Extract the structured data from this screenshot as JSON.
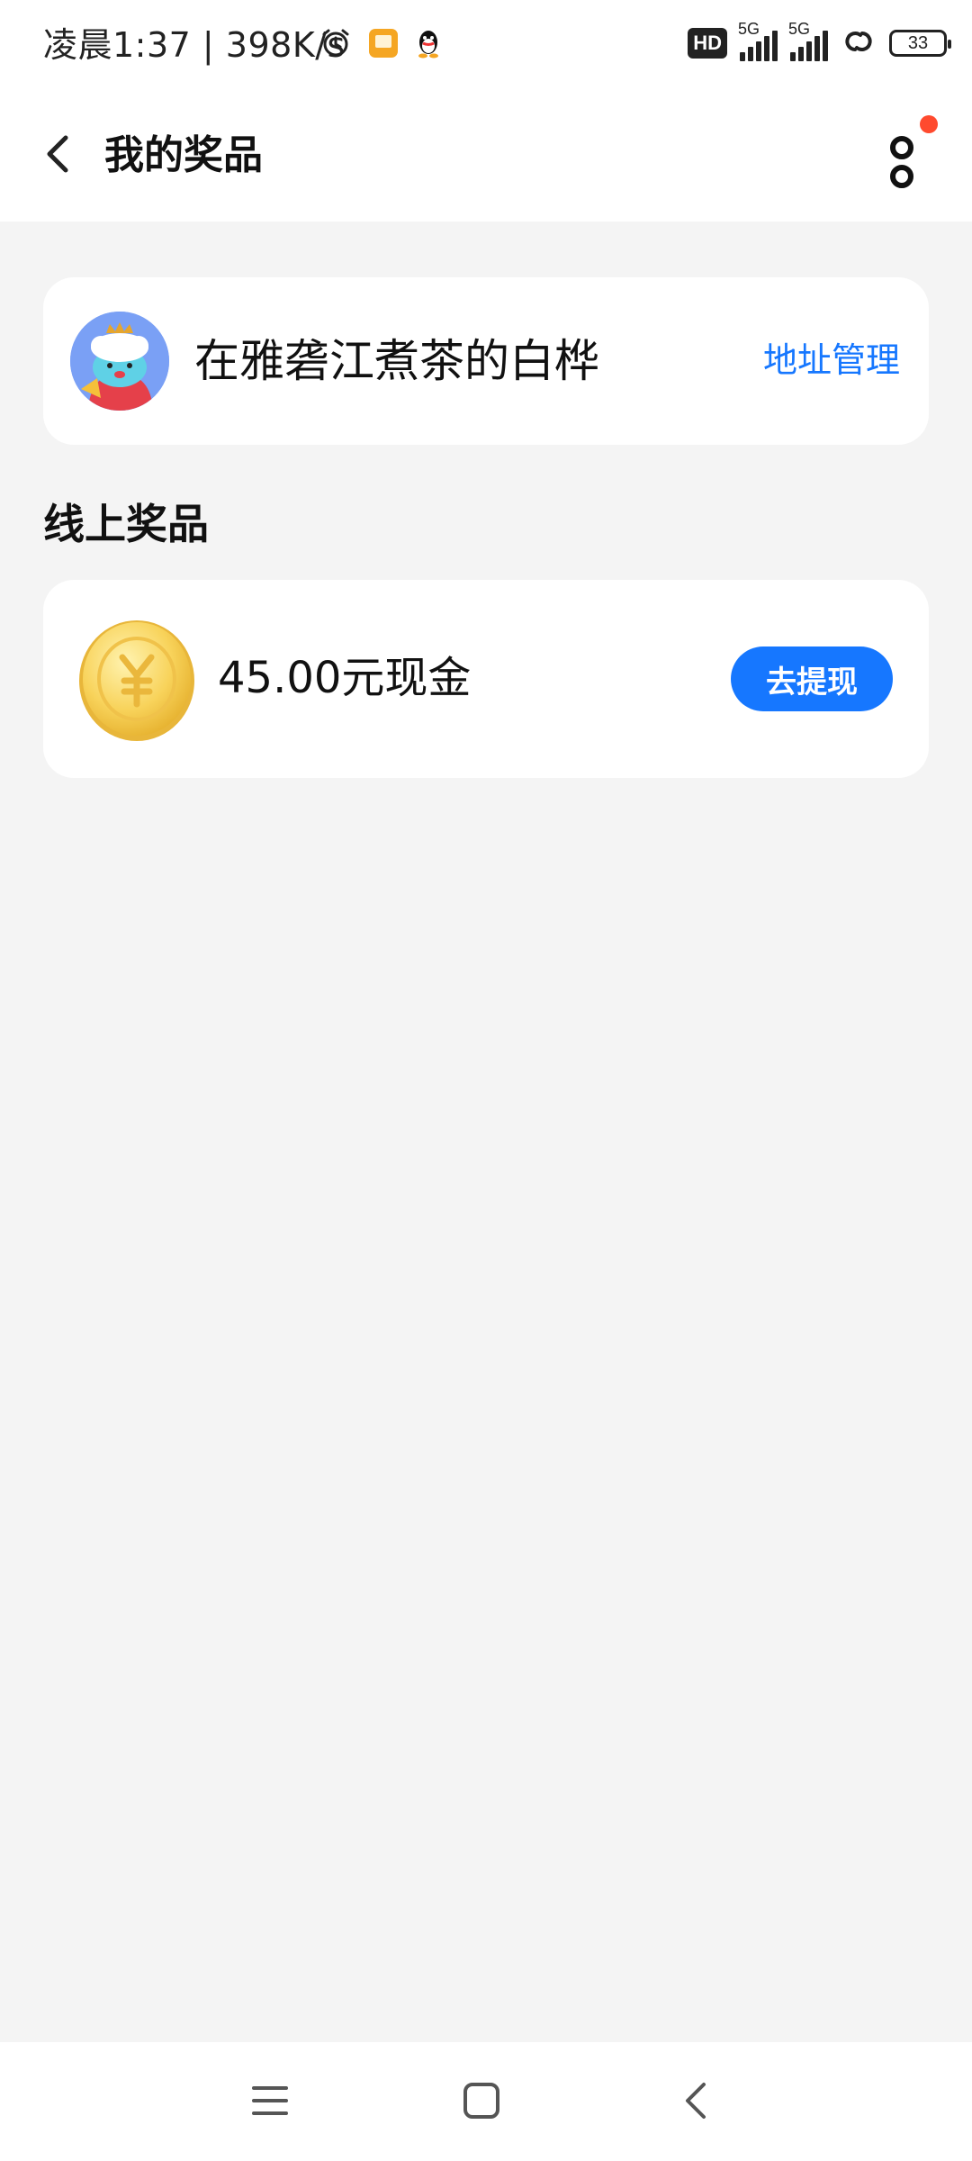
{
  "status_bar": {
    "time": "凌晨1:37 | 398K/s",
    "hd": "HD",
    "signal_1": "5G",
    "signal_2": "5G",
    "battery": "33",
    "icons": [
      "alarm-icon",
      "notes-app-icon",
      "qq-icon",
      "hd-icon",
      "signal-icon",
      "signal-icon",
      "link-icon",
      "battery-icon"
    ]
  },
  "header": {
    "title": "我的奖品",
    "back_icon": "chevron-left-icon",
    "more_icon": "more-vertical-icon"
  },
  "user": {
    "name": "在雅砻江煮茶的白桦",
    "address_link": "地址管理"
  },
  "online_prizes": {
    "section_title": "线上奖品",
    "items": [
      {
        "label": "45.00元现金",
        "icon": "gold-coin-icon",
        "action": "去提现"
      }
    ]
  },
  "nav": {
    "items": [
      "menu-icon",
      "home-icon",
      "back-icon"
    ]
  },
  "colors": {
    "accent": "#1677ff",
    "background": "#f4f4f4",
    "notify_dot": "#ff4a2e"
  }
}
